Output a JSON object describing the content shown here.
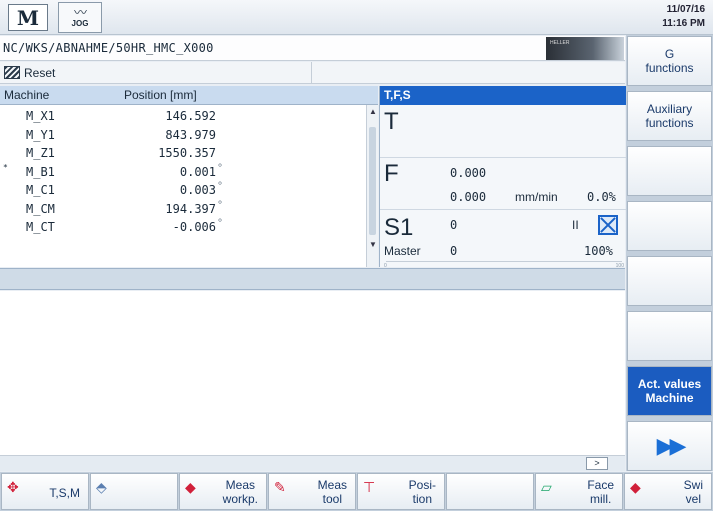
{
  "header": {
    "mode_machine": "M",
    "mode_jog_label": "JOG",
    "date": "11/07/16",
    "time": "11:16 PM"
  },
  "program": {
    "path": "NC/WKS/ABNAHME/50HR_HMC_X000",
    "image_badge": "HELLER"
  },
  "status": {
    "reset_label": "Reset"
  },
  "position_table": {
    "col_machine": "Machine",
    "col_position": "Position [mm]",
    "rows": [
      {
        "axis": "M_X1",
        "value": "146.592",
        "unit": "",
        "mark": ""
      },
      {
        "axis": "M_Y1",
        "value": "843.979",
        "unit": "",
        "mark": ""
      },
      {
        "axis": "M_Z1",
        "value": "1550.357",
        "unit": "",
        "mark": ""
      },
      {
        "axis": "M_B1",
        "value": "0.001",
        "unit": "°",
        "mark": "*"
      },
      {
        "axis": "M_C1",
        "value": "0.003",
        "unit": "°",
        "mark": ""
      },
      {
        "axis": "M_CM",
        "value": "194.397",
        "unit": "°",
        "mark": ""
      },
      {
        "axis": "M_CT",
        "value": "-0.006",
        "unit": "°",
        "mark": ""
      }
    ]
  },
  "tfs": {
    "title": "T,F,S",
    "t_label": "T",
    "f_label": "F",
    "f_value_1": "0.000",
    "f_value_2": "0.000",
    "f_unit": "mm/min",
    "f_override": "0.0%",
    "s_label": "S1",
    "s_value": "0",
    "s_state": "II",
    "s_sub_label": "Master",
    "s_sub_value": "0",
    "s_override": "100%",
    "bar_min": "0",
    "bar_max": "100"
  },
  "vertical_softkeys": [
    {
      "label": "G\nfunctions"
    },
    {
      "label": "Auxiliary\nfunctions"
    },
    {
      "label": ""
    },
    {
      "label": ""
    },
    {
      "label": ""
    },
    {
      "label": ""
    },
    {
      "label": "Act. values\nMachine"
    },
    {
      "label": "▶▶"
    }
  ],
  "horizontal_softkeys": [
    {
      "label": "T,S,M"
    },
    {
      "label": ""
    },
    {
      "label": "Meas\nworkp."
    },
    {
      "label": "Meas\ntool"
    },
    {
      "label": "Posi-\ntion"
    },
    {
      "label": ""
    },
    {
      "label": "Face\nmill."
    },
    {
      "label": "Swi\nvel"
    }
  ],
  "misc": {
    "next_arrow": ">"
  }
}
